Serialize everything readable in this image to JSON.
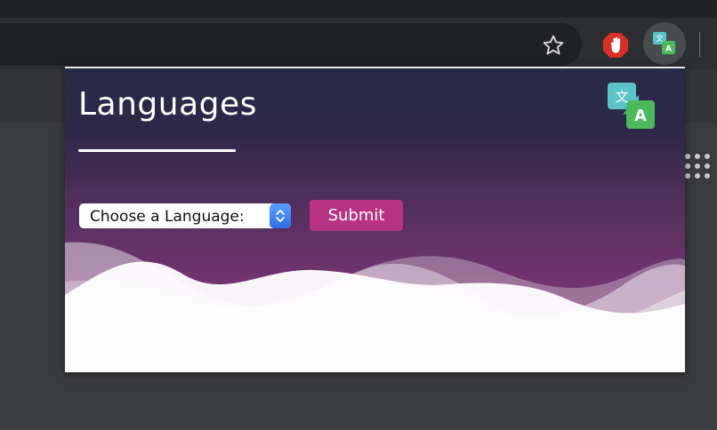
{
  "popup": {
    "title": "Languages",
    "select": {
      "value": "Choose a Language:"
    },
    "submit_label": "Submit"
  },
  "icons": {
    "bookmark": "star-icon",
    "blocker": "stop-hand-icon",
    "extension": "translate-icon",
    "apps": "apps-grid-icon"
  },
  "colors": {
    "accent": "#b83483",
    "gradient_top": "#262a46",
    "gradient_bottom": "#7a3a74",
    "blocker_red": "#d93025",
    "logo_teal": "#5cc4c9",
    "logo_green": "#4cb85c"
  }
}
